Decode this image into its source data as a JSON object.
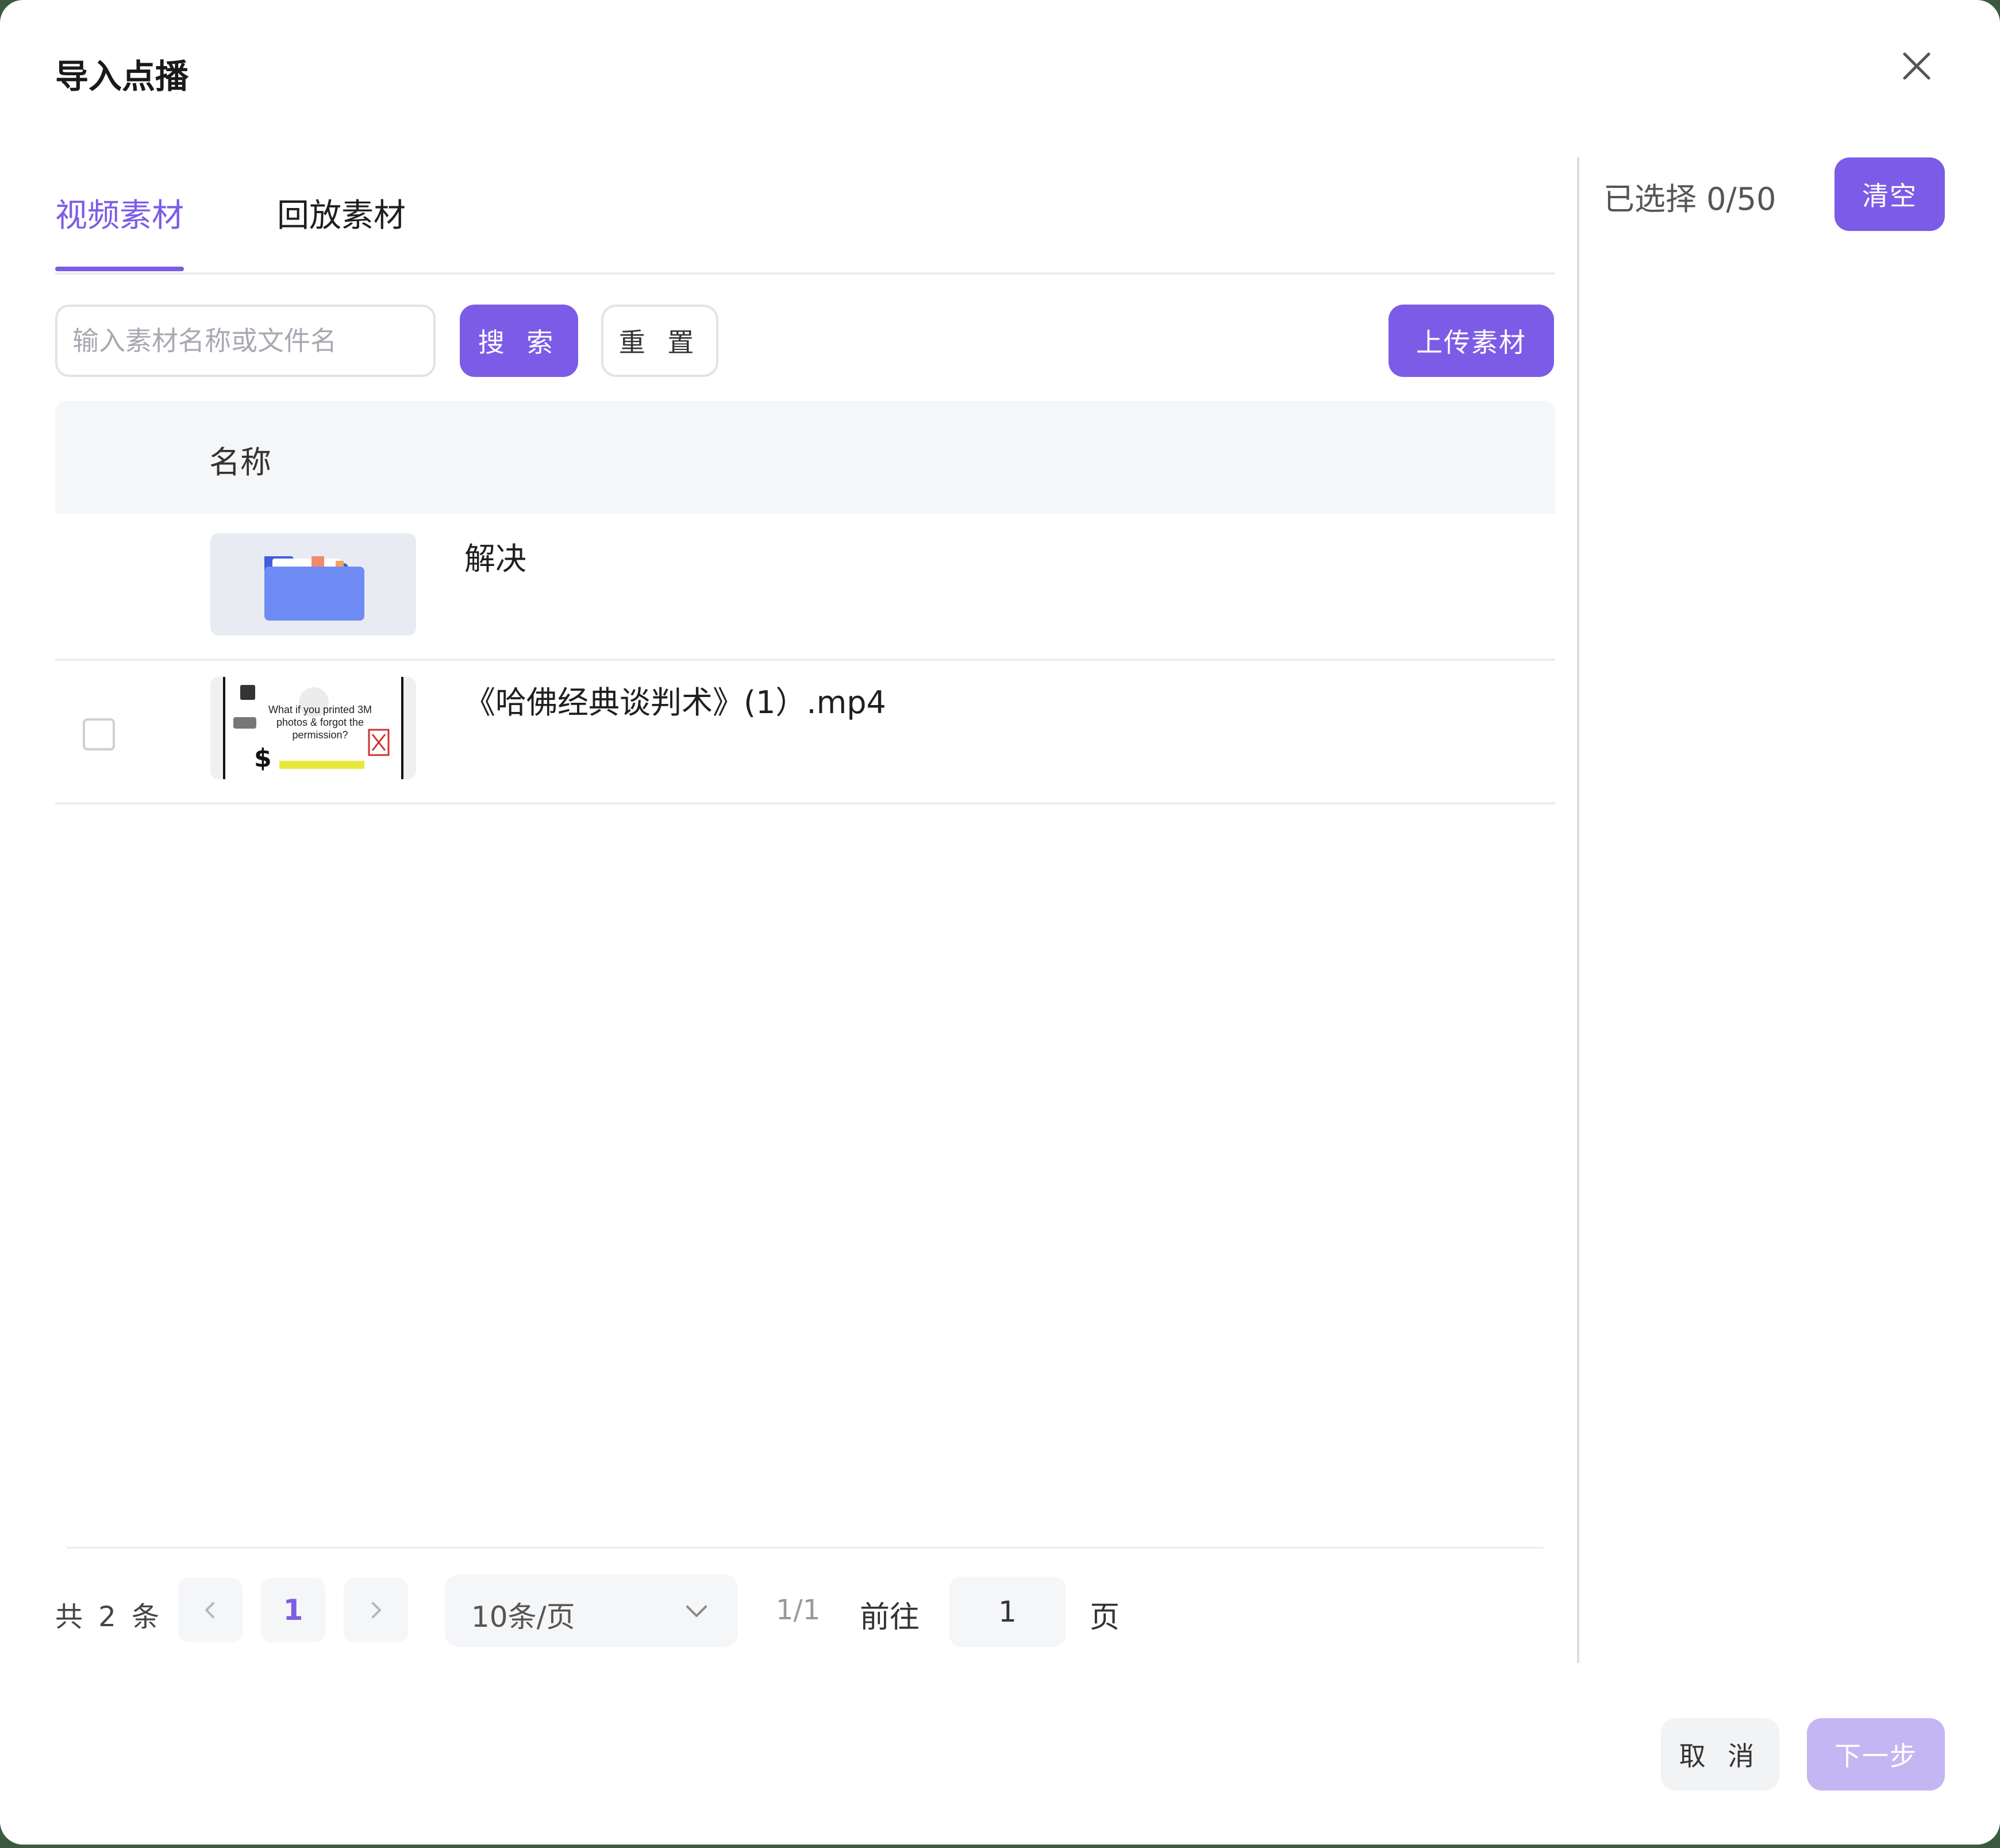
{
  "dialog": {
    "title": "导入点播"
  },
  "tabs": [
    {
      "label": "视频素材",
      "active": true
    },
    {
      "label": "回放素材",
      "active": false
    }
  ],
  "search": {
    "placeholder": "输入素材名称或文件名",
    "value": "",
    "search_label": "搜 索",
    "reset_label": "重 置",
    "upload_label": "上传素材"
  },
  "table": {
    "header_name": "名称",
    "rows": [
      {
        "name": "解决",
        "type": "folder",
        "thumb_icon": "folder-icon"
      },
      {
        "name": "《哈佛经典谈判术》(1）.mp4",
        "type": "video",
        "checked": false,
        "thumb_text": "What if you printed 3M photos & forgot the permission?"
      }
    ]
  },
  "pagination": {
    "total": "共 2 条",
    "current_page": "1",
    "page_size": "10条/页",
    "page_info": "1/1",
    "goto_label": "前往",
    "goto_value": "1",
    "page_suffix": "页"
  },
  "selection": {
    "label": "已选择 0/50",
    "clear_label": "清空"
  },
  "footer": {
    "cancel_label": "取 消",
    "next_label": "下一步"
  },
  "colors": {
    "accent": "#7c5ce6",
    "accent_disabled": "#c4b6f3",
    "folder_blue": "#6f8cf5"
  }
}
